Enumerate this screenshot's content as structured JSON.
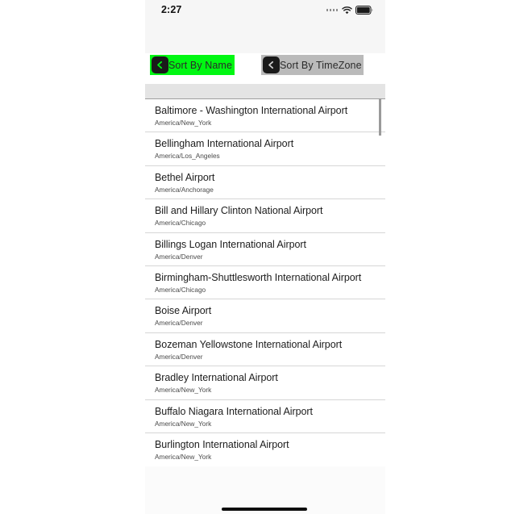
{
  "status_bar": {
    "time": "2:27",
    "signal_icon": "signal-dots-icon",
    "wifi_icon": "wifi-icon",
    "battery_icon": "battery-icon"
  },
  "toolbar": {
    "sort_by_name": {
      "label": "Sort By Name",
      "icon": "chevron-left-icon",
      "background_color": "#00f712",
      "active": true
    },
    "sort_by_timezone": {
      "label": "Sort By TimeZone",
      "icon": "chevron-left-icon",
      "background_color": "#bababa",
      "active": false
    }
  },
  "list": {
    "section_header": "",
    "rows": [
      {
        "name": "Baltimore - Washington International Airport",
        "timezone": "America/New_York"
      },
      {
        "name": "Bellingham International Airport",
        "timezone": "America/Los_Angeles"
      },
      {
        "name": "Bethel Airport",
        "timezone": "America/Anchorage"
      },
      {
        "name": "Bill and Hillary Clinton National Airport",
        "timezone": "America/Chicago"
      },
      {
        "name": "Billings Logan International Airport",
        "timezone": "America/Denver"
      },
      {
        "name": "Birmingham-Shuttlesworth International Airport",
        "timezone": "America/Chicago"
      },
      {
        "name": "Boise Airport",
        "timezone": "America/Denver"
      },
      {
        "name": "Bozeman Yellowstone International Airport",
        "timezone": "America/Denver"
      },
      {
        "name": "Bradley International Airport",
        "timezone": "America/New_York"
      },
      {
        "name": "Buffalo Niagara International Airport",
        "timezone": "America/New_York"
      },
      {
        "name": "Burlington International Airport",
        "timezone": "America/New_York"
      }
    ]
  },
  "home_indicator": {
    "label": ""
  }
}
